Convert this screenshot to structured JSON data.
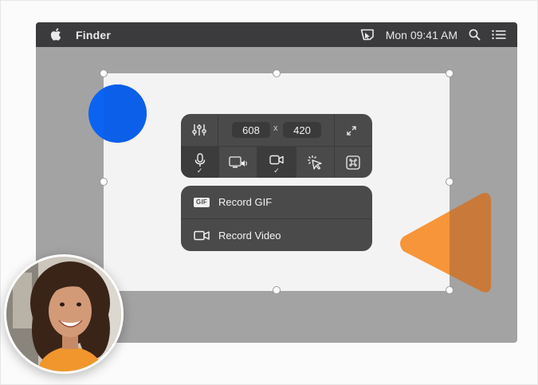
{
  "menubar": {
    "app_name": "Finder",
    "clock": "Mon 09:41 AM",
    "icons": [
      "apple-icon",
      "screen-capture-status-icon",
      "spotlight-search-icon",
      "notification-center-icon"
    ]
  },
  "capture": {
    "width": "608",
    "height": "420",
    "separator": "x"
  },
  "toolbar": {
    "row1": [
      "settings-sliders-icon",
      "width-field",
      "height-field",
      "fullscreen-expand-icon"
    ],
    "row2": [
      {
        "icon": "microphone-icon",
        "active": true,
        "checked": true
      },
      {
        "icon": "system-audio-icon",
        "active": false,
        "checked": false
      },
      {
        "icon": "camera-icon",
        "active": true,
        "checked": true
      },
      {
        "icon": "click-highlight-icon",
        "active": false,
        "checked": false
      },
      {
        "icon": "keystroke-icon",
        "active": false,
        "checked": false
      }
    ],
    "check_glyph": "✓"
  },
  "record_menu": {
    "gif_badge": "GIF",
    "record_gif": "Record GIF",
    "record_video": "Record Video"
  },
  "colors": {
    "menubar": "#3b3b3d",
    "desktop": "#a3a3a3",
    "panel": "#4a4a4a",
    "blue_shape": "#0c63f2",
    "orange_shape": "#f7953a"
  }
}
